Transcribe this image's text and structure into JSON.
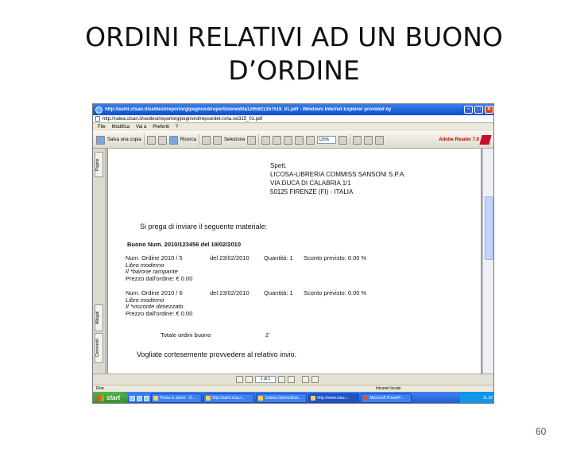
{
  "slide": {
    "title_line1": "ORDINI RELATIVI AD UN BUONO",
    "title_line2": "D’ORDINE",
    "page_number": "60"
  },
  "window": {
    "title": "http://aslnt.ctsan.it/sedtest/reportorg/pegniord/reportistenedita1265921357519_01.pdf - Windows Internet Explorer provided by",
    "address": "http://ratea.ctsan.it/sedtest/reportorg/pegniord/repsordet.rsrta.sw315_01.pdf",
    "menu": [
      "File",
      "Modifica",
      "Vai a",
      "Preferiti",
      "?"
    ]
  },
  "toolbar": {
    "save_label": "Salva una copia",
    "search_label": "Ricerca",
    "select_label": "Selezione",
    "zoom": "125%",
    "reader_label": "Adobe Reader 7.0"
  },
  "side_tabs": [
    "Pagine",
    "Allegati",
    "Commenti"
  ],
  "document": {
    "recipient": [
      "Spett.",
      "LICOSA-LIBRERIA COMMISS SANSONI S.P.A.",
      "VIA DUCA DI CALABRIA 1/1",
      "50125 FIRENZE (FI) - ITALIA"
    ],
    "request": "Si prega di inviare il seguente materiale:",
    "voucher": "Buono Num. 2010/123456   del 19/02/2010",
    "orders": [
      {
        "num": "Num. Ordine  2010 / 5",
        "date": "del 23/02/2010",
        "qty": "Quantità: 1",
        "discount": "Sconto previsto: 0.00 %",
        "type": "Libro moderno",
        "title": "Il *barone rampante",
        "price": "Prezzo dall'ordine: € 0.00"
      },
      {
        "num": "Num. Ordine  2010 / 6",
        "date": "del 23/02/2010",
        "qty": "Quantità: 1",
        "discount": "Sconto previsto: 0.00 %",
        "type": "Libro moderno",
        "title": "Il *visconte dimezzato",
        "price": "Prezzo dall'ordine: € 0.00"
      }
    ],
    "total_label": "Totale ordini buono",
    "total_value": "2",
    "closing": "Vogliate cortesemente provvedere al relativo invio."
  },
  "pdf_nav": {
    "page_box": "1 di 1"
  },
  "ie_status": {
    "left": "Fine",
    "zone": "Intranet locale"
  },
  "taskbar": {
    "start_label": "start",
    "items": [
      "Posta in arrivo - O...",
      "http://aslnt.ctsa.i...",
      "Sebina OpenLibrar...",
      "http://www.ctsa.i...",
      "Microsoft PowerP..."
    ],
    "clock": "11.32"
  }
}
